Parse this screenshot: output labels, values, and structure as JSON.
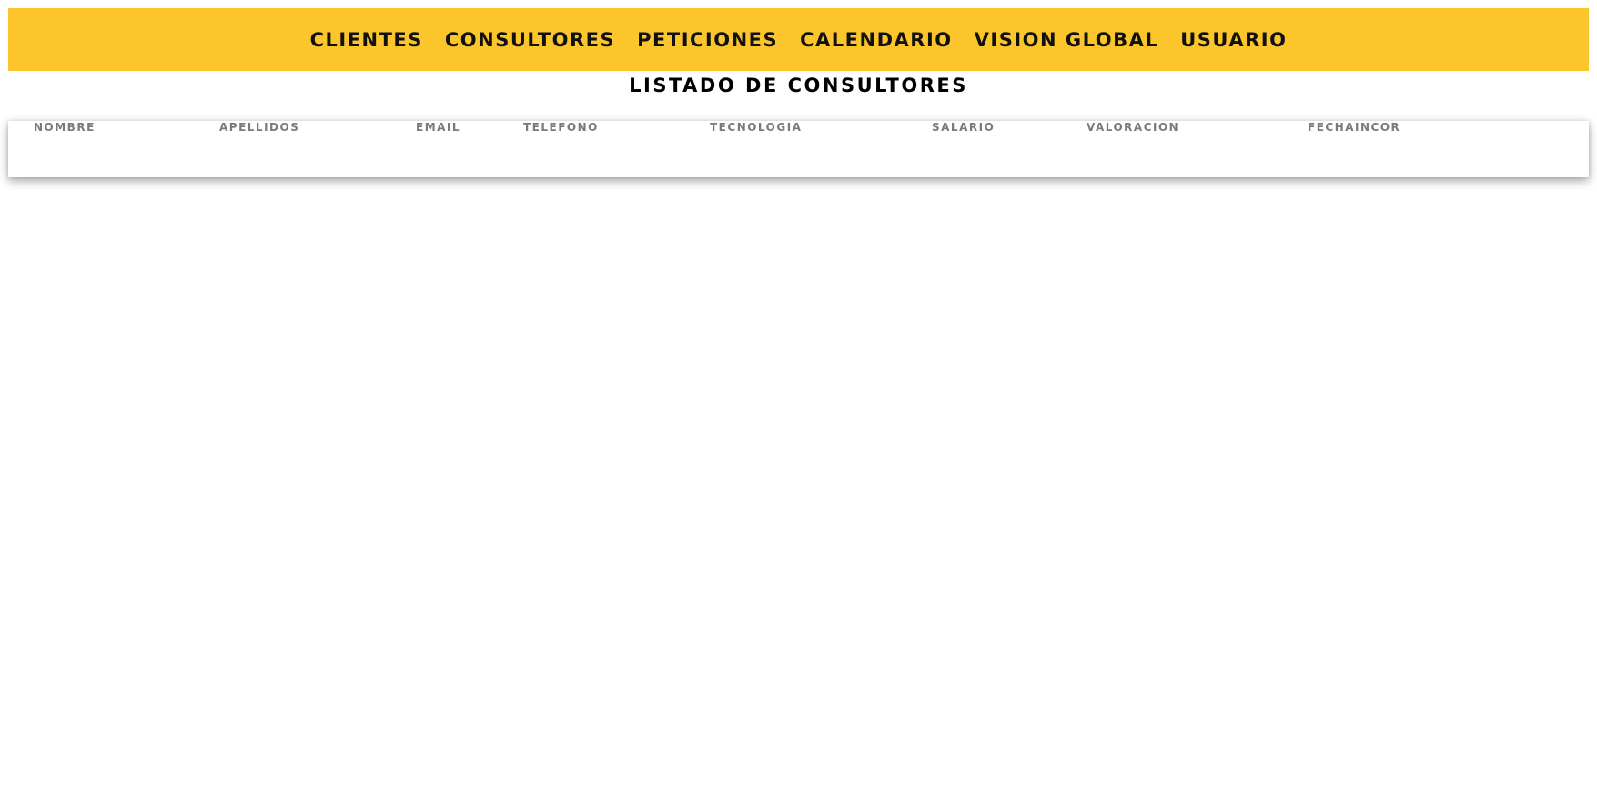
{
  "nav": {
    "items": [
      {
        "label": "CLIENTES"
      },
      {
        "label": "CONSULTORES"
      },
      {
        "label": "PETICIONES"
      },
      {
        "label": "CALENDARIO"
      },
      {
        "label": "VISION GLOBAL"
      },
      {
        "label": "USUARIO"
      }
    ]
  },
  "page": {
    "title": "LISTADO DE CONSULTORES"
  },
  "table": {
    "columns": [
      "NOMBRE",
      "APELLIDOS",
      "EMAIL",
      "TELEFONO",
      "TECNOLOGIA",
      "SALARIO",
      "VALORACION",
      "FECHAINCOR"
    ],
    "rows": []
  },
  "colors": {
    "header_bar": "#fdc52c",
    "column_header_text": "#7a7a7a",
    "nav_text": "#111111"
  }
}
